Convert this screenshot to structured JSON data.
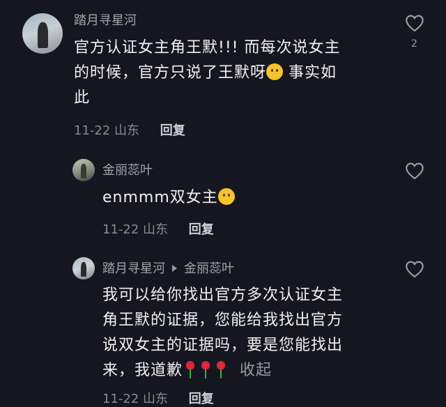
{
  "comment1": {
    "author": "踏月寻星河",
    "text_line1": "官方认证女主角王默!!! 而每次说女主",
    "text_line2a": "的时候，官方只说了王默呀",
    "text_line2b": " 事实如",
    "text_line3": "此",
    "date": "11-22",
    "location": "山东",
    "reply_label": "回复",
    "like_count": "2"
  },
  "reply1": {
    "author": "金丽蕊叶",
    "text": "enmmm双女主",
    "date": "11-22",
    "location": "山东",
    "reply_label": "回复"
  },
  "reply2": {
    "author": "踏月寻星河",
    "reply_to": "金丽蕊叶",
    "text_line1": "我可以给你找出官方多次认证女主",
    "text_line2": "角王默的证据，您能给我找出官方",
    "text_line3": "说双女主的证据吗，要是您能找出",
    "text_line4": "来，我道歉",
    "collapse_label": "收起",
    "date": "11-22",
    "location": "山东",
    "reply_label": "回复"
  },
  "icons": {
    "like": "heart-outline-icon",
    "reply_arrow": "triangle-right-icon",
    "emoji1": "yum-face-emoji",
    "emoji2": "crying-face-emoji",
    "emoji3": "rose-emoji"
  }
}
